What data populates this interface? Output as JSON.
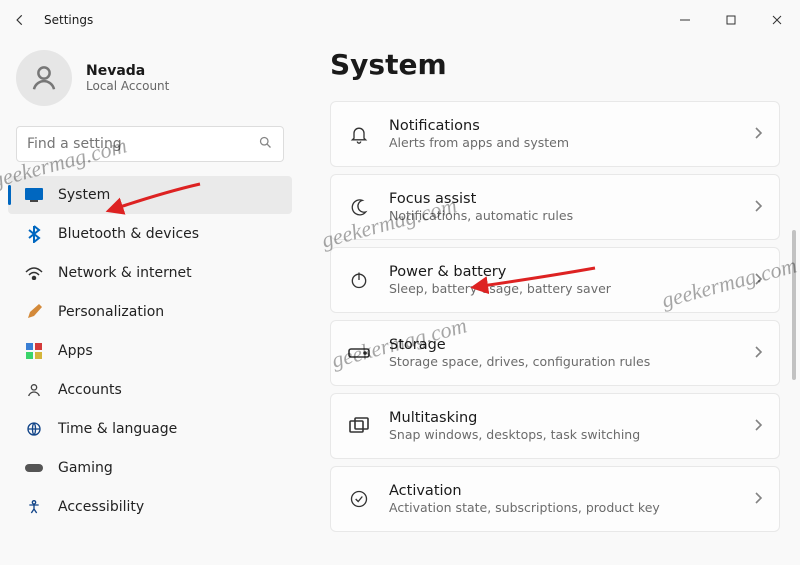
{
  "window": {
    "title": "Settings"
  },
  "profile": {
    "name": "Nevada",
    "account_type": "Local Account"
  },
  "search": {
    "placeholder": "Find a setting"
  },
  "nav": {
    "items": [
      {
        "key": "system",
        "label": "System",
        "active": true
      },
      {
        "key": "bluetooth",
        "label": "Bluetooth & devices",
        "active": false
      },
      {
        "key": "network",
        "label": "Network & internet",
        "active": false
      },
      {
        "key": "personal",
        "label": "Personalization",
        "active": false
      },
      {
        "key": "apps",
        "label": "Apps",
        "active": false
      },
      {
        "key": "accounts",
        "label": "Accounts",
        "active": false
      },
      {
        "key": "time",
        "label": "Time & language",
        "active": false
      },
      {
        "key": "gaming",
        "label": "Gaming",
        "active": false
      },
      {
        "key": "accessibility",
        "label": "Accessibility",
        "active": false
      }
    ]
  },
  "page": {
    "title": "System",
    "cards": [
      {
        "key": "notifications",
        "title": "Notifications",
        "subtitle": "Alerts from apps and system"
      },
      {
        "key": "focus",
        "title": "Focus assist",
        "subtitle": "Notifications, automatic rules"
      },
      {
        "key": "power",
        "title": "Power & battery",
        "subtitle": "Sleep, battery usage, battery saver"
      },
      {
        "key": "storage",
        "title": "Storage",
        "subtitle": "Storage space, drives, configuration rules"
      },
      {
        "key": "multitask",
        "title": "Multitasking",
        "subtitle": "Snap windows, desktops, task switching"
      },
      {
        "key": "activation",
        "title": "Activation",
        "subtitle": "Activation state, subscriptions, product key"
      }
    ]
  },
  "annotations": {
    "watermark_text": "geekermag.com",
    "arrows": [
      {
        "target": "nav.system"
      },
      {
        "target": "card.power"
      }
    ]
  },
  "colors": {
    "accent": "#0067c0",
    "arrow": "#d22"
  }
}
